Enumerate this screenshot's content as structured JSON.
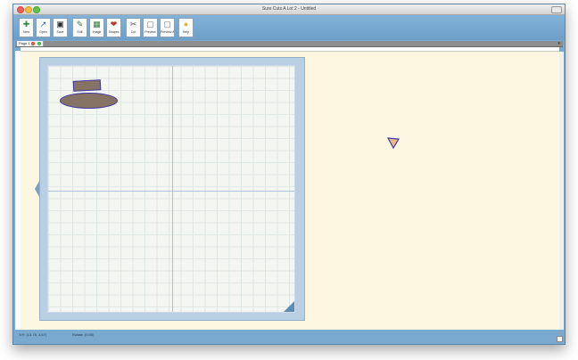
{
  "window": {
    "title": "Sure Cuts A Lot 2 - Untitled"
  },
  "toolbar": {
    "buttons": [
      {
        "label": "New",
        "icon": "new-document-icon",
        "glyph": "✚",
        "color": "#2e8b3a"
      },
      {
        "label": "Open",
        "icon": "open-folder-icon",
        "glyph": "↗",
        "color": "#2d5fa3"
      },
      {
        "label": "Save",
        "icon": "save-disk-icon",
        "glyph": "▣",
        "color": "#2a2a2a"
      },
      {
        "label": "Edit",
        "icon": "edit-icon",
        "glyph": "✎",
        "color": "#3b7a3b"
      },
      {
        "label": "Image",
        "icon": "image-icon",
        "glyph": "▦",
        "color": "#2f7c3a"
      },
      {
        "label": "Shapes",
        "icon": "shapes-icon",
        "glyph": "❤",
        "color": "#b53a2a"
      },
      {
        "label": "Cut",
        "icon": "cut-icon",
        "glyph": "✂",
        "color": "#555555"
      },
      {
        "label": "Preview",
        "icon": "preview-icon",
        "glyph": "▢",
        "color": "#777777"
      },
      {
        "label": "Preview All",
        "icon": "preview-all-icon",
        "glyph": "▢",
        "color": "#777777"
      },
      {
        "label": "Help",
        "icon": "help-bulb-icon",
        "glyph": "●",
        "color": "#e6b91e"
      }
    ]
  },
  "tabs": {
    "active_label": "Page 1"
  },
  "status": {
    "left": "X/Y: (13.75, 3.67)",
    "right": "Rotate: (0.00)"
  },
  "colors": {
    "canvas": "#fdf7e1",
    "chrome": "#7aa9cf",
    "mat": "#b8cfe4",
    "shape_fill": "#8e7a6c",
    "shape_stroke": "#3f3aa0"
  }
}
